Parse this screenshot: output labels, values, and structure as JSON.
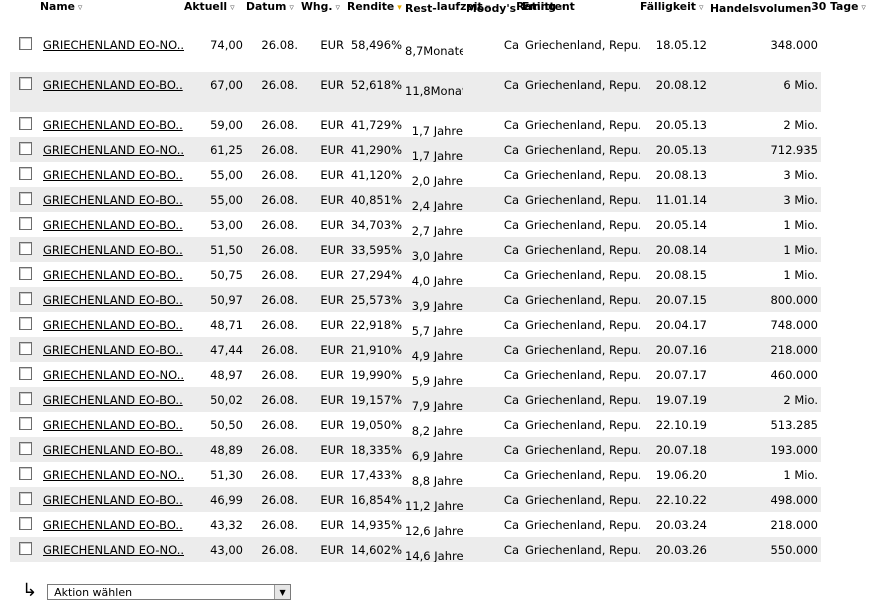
{
  "headers": {
    "name": "Name",
    "aktuell": "Aktuell",
    "datum": "Datum",
    "whg": "Whg.",
    "rendite": "Rendite",
    "restlaufzeit_1": "Rest-",
    "restlaufzeit_2": "laufzeit",
    "moodys_1": "Moody's",
    "moodys_2": "Rating",
    "emittent": "Emittent",
    "faelligkeit": "Fälligkeit",
    "handelsvolumen_1": "Handelsvolumen",
    "handelsvolumen_2": "30 Tage"
  },
  "rows": [
    {
      "name": "GRIECHENLAND EO-NO..",
      "aktuell": "74,00",
      "datum": "26.08.",
      "whg": "EUR",
      "rendite": "58,496%",
      "rest1": "8,7",
      "rest2": "Monate",
      "rating": "Ca",
      "emittent": "Griechenland, Repu..",
      "faellig": "18.05.12",
      "volumen": "348.000"
    },
    {
      "name": "GRIECHENLAND EO-BO..",
      "aktuell": "67,00",
      "datum": "26.08.",
      "whg": "EUR",
      "rendite": "52,618%",
      "rest1": "11,8",
      "rest2": "Monate",
      "rating": "Ca",
      "emittent": "Griechenland, Repu..",
      "faellig": "20.08.12",
      "volumen": "6 Mio."
    },
    {
      "name": "GRIECHENLAND EO-BO..",
      "aktuell": "59,00",
      "datum": "26.08.",
      "whg": "EUR",
      "rendite": "41,729%",
      "rest1": "1,7 Jahre",
      "rest2": "",
      "rating": "Ca",
      "emittent": "Griechenland, Repu..",
      "faellig": "20.05.13",
      "volumen": "2 Mio."
    },
    {
      "name": "GRIECHENLAND EO-NO..",
      "aktuell": "61,25",
      "datum": "26.08.",
      "whg": "EUR",
      "rendite": "41,290%",
      "rest1": "1,7 Jahre",
      "rest2": "",
      "rating": "Ca",
      "emittent": "Griechenland, Repu..",
      "faellig": "20.05.13",
      "volumen": "712.935"
    },
    {
      "name": "GRIECHENLAND EO-BO..",
      "aktuell": "55,00",
      "datum": "26.08.",
      "whg": "EUR",
      "rendite": "41,120%",
      "rest1": "2,0 Jahre",
      "rest2": "",
      "rating": "Ca",
      "emittent": "Griechenland, Repu..",
      "faellig": "20.08.13",
      "volumen": "3 Mio."
    },
    {
      "name": "GRIECHENLAND EO-BO..",
      "aktuell": "55,00",
      "datum": "26.08.",
      "whg": "EUR",
      "rendite": "40,851%",
      "rest1": "2,4 Jahre",
      "rest2": "",
      "rating": "Ca",
      "emittent": "Griechenland, Repu..",
      "faellig": "11.01.14",
      "volumen": "3 Mio."
    },
    {
      "name": "GRIECHENLAND EO-BO..",
      "aktuell": "53,00",
      "datum": "26.08.",
      "whg": "EUR",
      "rendite": "34,703%",
      "rest1": "2,7 Jahre",
      "rest2": "",
      "rating": "Ca",
      "emittent": "Griechenland, Repu..",
      "faellig": "20.05.14",
      "volumen": "1 Mio."
    },
    {
      "name": "GRIECHENLAND EO-BO..",
      "aktuell": "51,50",
      "datum": "26.08.",
      "whg": "EUR",
      "rendite": "33,595%",
      "rest1": "3,0 Jahre",
      "rest2": "",
      "rating": "Ca",
      "emittent": "Griechenland, Repu..",
      "faellig": "20.08.14",
      "volumen": "1 Mio."
    },
    {
      "name": "GRIECHENLAND EO-BO..",
      "aktuell": "50,75",
      "datum": "26.08.",
      "whg": "EUR",
      "rendite": "27,294%",
      "rest1": "4,0 Jahre",
      "rest2": "",
      "rating": "Ca",
      "emittent": "Griechenland, Repu..",
      "faellig": "20.08.15",
      "volumen": "1 Mio."
    },
    {
      "name": "GRIECHENLAND EO-BO..",
      "aktuell": "50,97",
      "datum": "26.08.",
      "whg": "EUR",
      "rendite": "25,573%",
      "rest1": "3,9 Jahre",
      "rest2": "",
      "rating": "Ca",
      "emittent": "Griechenland, Repu..",
      "faellig": "20.07.15",
      "volumen": "800.000"
    },
    {
      "name": "GRIECHENLAND EO-BO..",
      "aktuell": "48,71",
      "datum": "26.08.",
      "whg": "EUR",
      "rendite": "22,918%",
      "rest1": "5,7 Jahre",
      "rest2": "",
      "rating": "Ca",
      "emittent": "Griechenland, Repu..",
      "faellig": "20.04.17",
      "volumen": "748.000"
    },
    {
      "name": "GRIECHENLAND EO-BO..",
      "aktuell": "47,44",
      "datum": "26.08.",
      "whg": "EUR",
      "rendite": "21,910%",
      "rest1": "4,9 Jahre",
      "rest2": "",
      "rating": "Ca",
      "emittent": "Griechenland, Repu..",
      "faellig": "20.07.16",
      "volumen": "218.000"
    },
    {
      "name": "GRIECHENLAND EO-NO..",
      "aktuell": "48,97",
      "datum": "26.08.",
      "whg": "EUR",
      "rendite": "19,990%",
      "rest1": "5,9 Jahre",
      "rest2": "",
      "rating": "Ca",
      "emittent": "Griechenland, Repu..",
      "faellig": "20.07.17",
      "volumen": "460.000"
    },
    {
      "name": "GRIECHENLAND EO-BO..",
      "aktuell": "50,02",
      "datum": "26.08.",
      "whg": "EUR",
      "rendite": "19,157%",
      "rest1": "7,9 Jahre",
      "rest2": "",
      "rating": "Ca",
      "emittent": "Griechenland, Repu..",
      "faellig": "19.07.19",
      "volumen": "2 Mio."
    },
    {
      "name": "GRIECHENLAND EO-BO..",
      "aktuell": "50,50",
      "datum": "26.08.",
      "whg": "EUR",
      "rendite": "19,050%",
      "rest1": "8,2 Jahre",
      "rest2": "",
      "rating": "Ca",
      "emittent": "Griechenland, Repu..",
      "faellig": "22.10.19",
      "volumen": "513.285"
    },
    {
      "name": "GRIECHENLAND EO-BO..",
      "aktuell": "48,89",
      "datum": "26.08.",
      "whg": "EUR",
      "rendite": "18,335%",
      "rest1": "6,9 Jahre",
      "rest2": "",
      "rating": "Ca",
      "emittent": "Griechenland, Repu..",
      "faellig": "20.07.18",
      "volumen": "193.000"
    },
    {
      "name": "GRIECHENLAND EO-NO..",
      "aktuell": "51,30",
      "datum": "26.08.",
      "whg": "EUR",
      "rendite": "17,433%",
      "rest1": "8,8 Jahre",
      "rest2": "",
      "rating": "Ca",
      "emittent": "Griechenland, Repu..",
      "faellig": "19.06.20",
      "volumen": "1 Mio."
    },
    {
      "name": "GRIECHENLAND EO-BO..",
      "aktuell": "46,99",
      "datum": "26.08.",
      "whg": "EUR",
      "rendite": "16,854%",
      "rest1": "11,2 Jahre",
      "rest2": "",
      "rating": "Ca",
      "emittent": "Griechenland, Repu..",
      "faellig": "22.10.22",
      "volumen": "498.000"
    },
    {
      "name": "GRIECHENLAND EO-BO..",
      "aktuell": "43,32",
      "datum": "26.08.",
      "whg": "EUR",
      "rendite": "14,935%",
      "rest1": "12,6 Jahre",
      "rest2": "",
      "rating": "Ca",
      "emittent": "Griechenland, Repu..",
      "faellig": "20.03.24",
      "volumen": "218.000"
    },
    {
      "name": "GRIECHENLAND EO-NO..",
      "aktuell": "43,00",
      "datum": "26.08.",
      "whg": "EUR",
      "rendite": "14,602%",
      "rest1": "14,6 Jahre",
      "rest2": "",
      "rating": "Ca",
      "emittent": "Griechenland, Repu..",
      "faellig": "20.03.26",
      "volumen": "550.000"
    }
  ],
  "action_select": {
    "value": "Aktion wählen"
  },
  "icons": {
    "sort": "sort-down-arrow-icon",
    "corner": "corner-arrow-icon",
    "dropdown": "dropdown-arrow-icon"
  },
  "colors": {
    "row_alt": "#ececec",
    "sort_active": "#e6a800"
  }
}
